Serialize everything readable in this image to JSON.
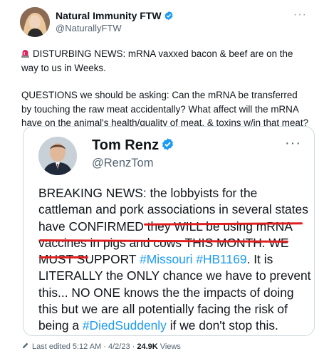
{
  "tweet": {
    "author_name": "Natural Immunity FTW",
    "author_handle": "@NaturallyFTW",
    "more_icon": "···",
    "siren_icon": "siren-emoji",
    "text_p1": "DISTURBING NEWS: mRNA vaxxed bacon & beef are on the way to us in Weeks.",
    "text_p2": "QUESTIONS we should be asking: Can the mRNA be transferred by touching the raw meat accidentally? What affect will the mRNA have on the animal's health/quality of meat, & toxins w/in that meat?"
  },
  "quote": {
    "author_name": "Tom Renz",
    "author_handle": "@RenzTom",
    "more_icon": "···",
    "text_a": "BREAKING NEWS: the lobbyists for the cattleman and pork associations in several states have CONFIRMED they WILL be using mRNA vaccines in pigs and cows THIS MONTH. WE MUST SUPPORT ",
    "tag1": "#Missouri",
    "tag2": "#HB1169",
    "text_b": ". It is LITERALLY the ONLY chance we have to prevent this... NO ONE knows the the impacts of doing this but we are all potentially facing the risk of being a ",
    "tag3": "#DiedSuddenly",
    "text_c": " if we don't stop this."
  },
  "footer": {
    "edited": "Last edited 5:12 AM · 4/2/23 · ",
    "views_count": "24.9K",
    "views_label": " Views"
  },
  "colors": {
    "verified": "#1d9bf0",
    "link": "#1d9bf0",
    "annotation": "#e02020"
  }
}
